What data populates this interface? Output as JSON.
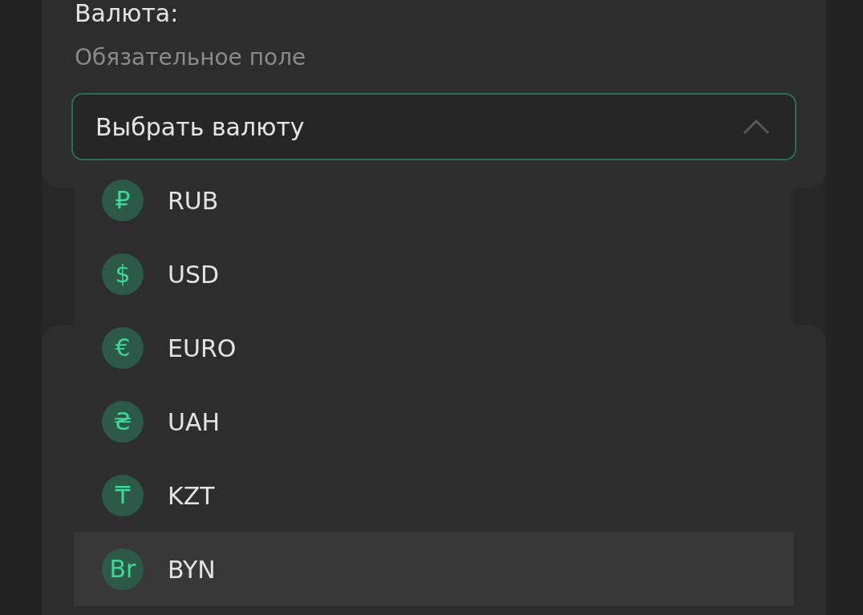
{
  "field": {
    "label": "Валюта:",
    "hint": "Обязательное поле",
    "placeholder": "Выбрать валюту",
    "expanded": true
  },
  "options": [
    {
      "symbol": "₽",
      "code": "RUB",
      "highlighted": false
    },
    {
      "symbol": "$",
      "code": "USD",
      "highlighted": false
    },
    {
      "symbol": "€",
      "code": "EURO",
      "highlighted": false
    },
    {
      "symbol": "₴",
      "code": "UAH",
      "highlighted": false
    },
    {
      "symbol": "₸",
      "code": "KZT",
      "highlighted": false
    },
    {
      "symbol": "Br",
      "code": "BYN",
      "highlighted": true
    }
  ]
}
